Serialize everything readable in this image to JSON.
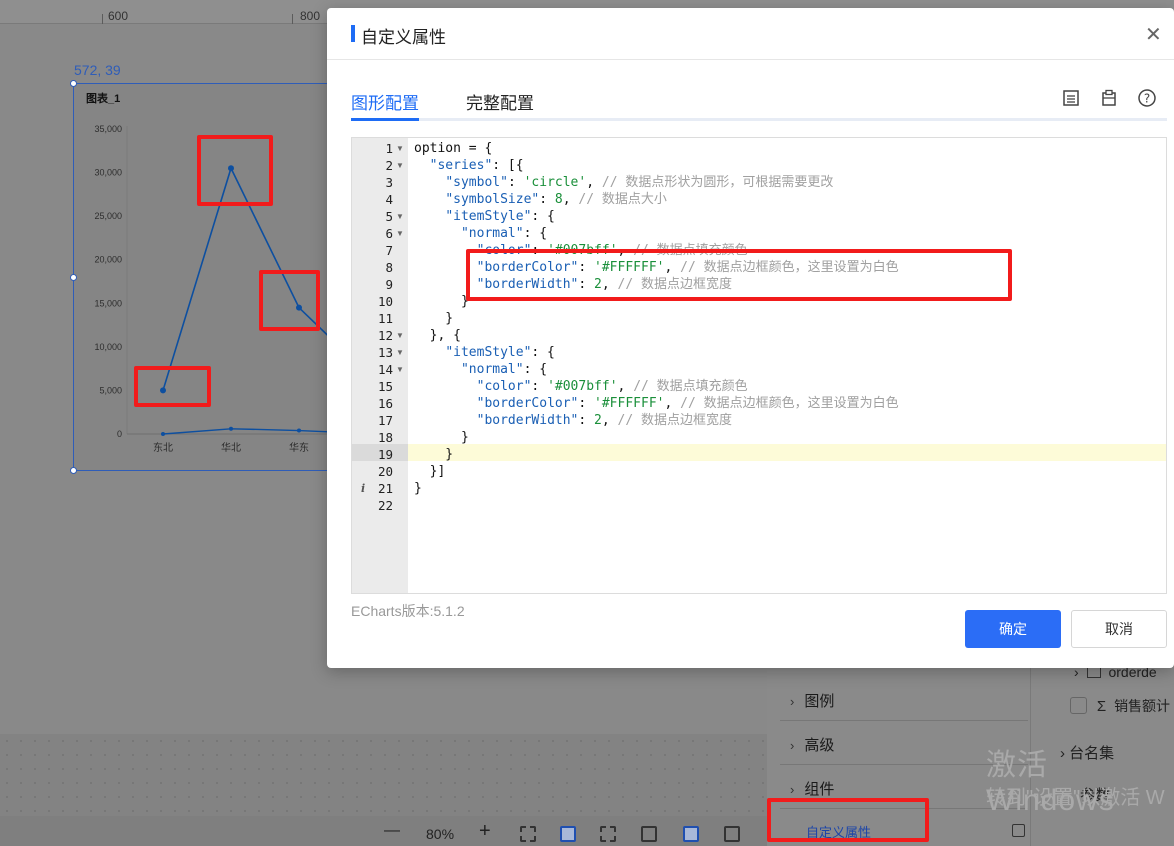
{
  "ruler": {
    "labels": [
      "600",
      "800"
    ]
  },
  "canvas": {
    "coord_readout": "572, 39",
    "chart": {
      "title": "图表_1",
      "y_ticks": [
        "35,000",
        "30,000",
        "25,000",
        "20,000",
        "15,000",
        "10,000",
        "5,000",
        "0"
      ],
      "x_ticks": [
        "东北",
        "华北",
        "华东"
      ]
    }
  },
  "chart_data": {
    "type": "line",
    "title": "图表_1",
    "categories": [
      "东北",
      "华北",
      "华东"
    ],
    "ylim": [
      0,
      35000
    ],
    "series": [
      {
        "values": [
          5000,
          30500,
          14500
        ]
      },
      {
        "values": [
          0,
          600,
          400
        ]
      }
    ],
    "color": "#0d4fa0"
  },
  "modal": {
    "title": "自定义属性",
    "tabs": [
      "图形配置",
      "完整配置"
    ],
    "active_tab": "图形配置",
    "toolbar_icons": [
      "document-icon",
      "clipboard-icon",
      "help-icon"
    ],
    "version": "ECharts版本:5.1.2",
    "ok_label": "确定",
    "cancel_label": "取消",
    "accent_color": "#1e6cf5"
  },
  "editor": {
    "lines": [
      "option = {",
      "  \"series\": [{",
      "    \"symbol\": 'circle', // 数据点形状为圆形，可根据需要更改",
      "    \"symbolSize\": 8, // 数据点大小",
      "    \"itemStyle\": {",
      "      \"normal\": {",
      "        \"color\": '#007bff', // 数据点填充颜色",
      "        \"borderColor\": '#FFFFFF', // 数据点边框颜色，这里设置为白色",
      "        \"borderWidth\": 2, // 数据点边框宽度",
      "      }",
      "    }",
      "  }, {",
      "    \"itemStyle\": {",
      "      \"normal\": {",
      "        \"color\": '#007bff', // 数据点填充颜色",
      "        \"borderColor\": '#FFFFFF', // 数据点边框颜色，这里设置为白色",
      "        \"borderWidth\": 2, // 数据点边框宽度",
      "      }",
      "    }",
      "  }]",
      "}",
      ""
    ],
    "active_line": "19"
  },
  "right_panel": {
    "items": [
      "图例",
      "高级",
      "组件",
      "自定义属性"
    ],
    "field_partial": "orderde",
    "field_sum": "销售额计",
    "params_partial": "台名集",
    "params_label": "参数"
  },
  "watermark": {
    "line1": "激活 Windows",
    "line2": "转到\"设置\"以激活 W"
  },
  "bottom_toolbar": {
    "zoom": "80%"
  }
}
